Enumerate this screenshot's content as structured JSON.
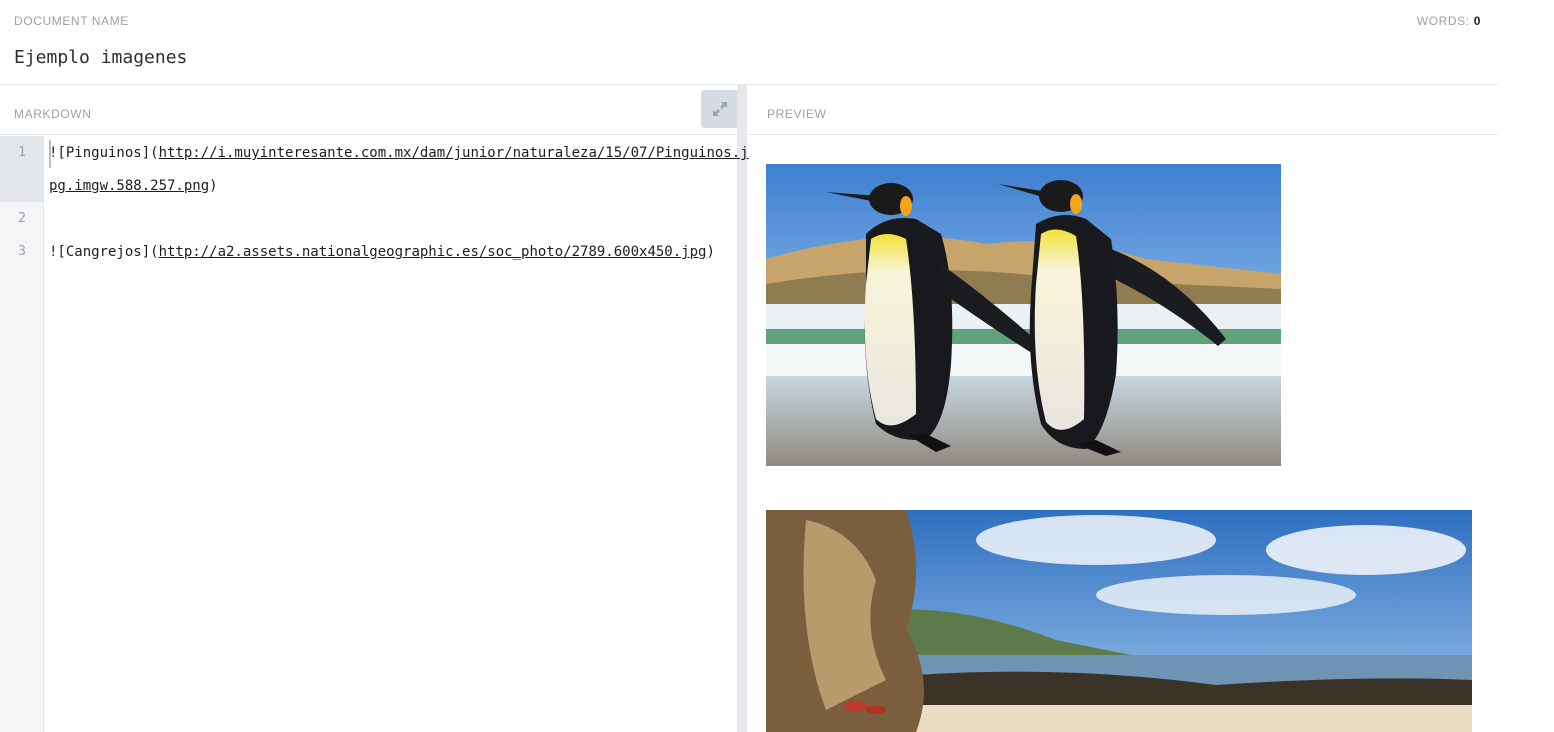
{
  "header": {
    "doc_name_label": "DOCUMENT NAME",
    "doc_title": "Ejemplo imagenes",
    "words_label": "WORDS:",
    "words_count": "0"
  },
  "markdown_pane": {
    "label": "MARKDOWN",
    "expand_icon": "expand-arrows-icon",
    "line_numbers": [
      "1",
      "2",
      "3"
    ],
    "lines": [
      {
        "prefix": "![Pinguinos](",
        "url_a": "http://i.muyinteresante.com.mx/dam/junior/naturaleza/15/07/Pinguinos.j",
        "url_b": "pg.imgw.588.257.png",
        "suffix": ")"
      },
      {
        "text": ""
      },
      {
        "prefix": "![Cangrejos](",
        "url": "http://a2.assets.nationalgeographic.es/soc_photo/2789.600x450.jpg",
        "suffix": ")"
      }
    ]
  },
  "preview_pane": {
    "label": "PREVIEW",
    "images": [
      {
        "alt": "Pinguinos"
      },
      {
        "alt": "Cangrejos"
      }
    ]
  },
  "colors": {
    "label_gray": "#9aa1ab",
    "border": "#e6e8ec",
    "gutter_bg": "#f4f5f7",
    "expand_btn_bg": "#d7dbe3"
  }
}
